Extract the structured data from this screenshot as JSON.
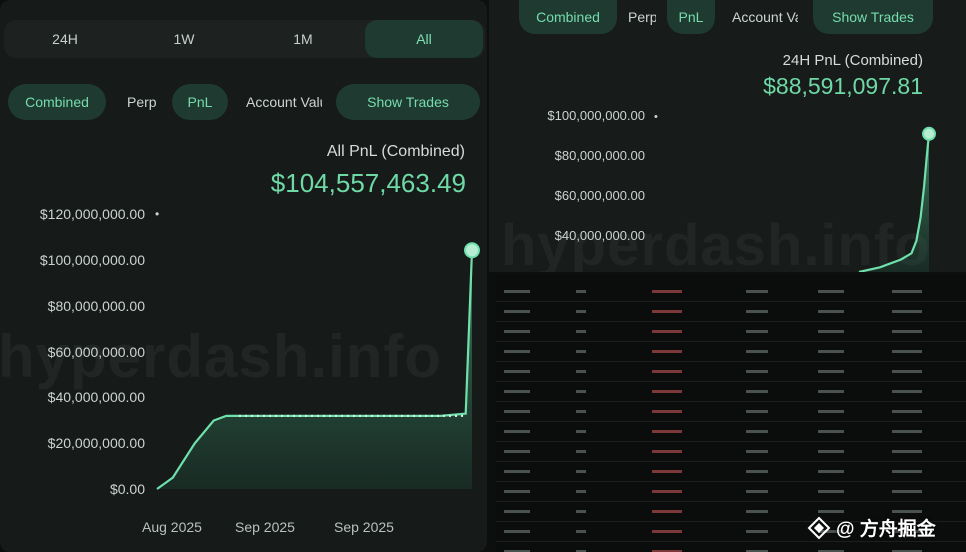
{
  "left": {
    "watermark": "hyperdash.info",
    "timeframes": [
      "24H",
      "1W",
      "1M",
      "All"
    ],
    "active_timeframe": "All",
    "tabs": {
      "combined": "Combined",
      "perp": "Perp",
      "pnl": "PnL",
      "account_value": "Account Value",
      "show_trades": "Show Trades"
    },
    "pnl_label": "All PnL (Combined)",
    "pnl_value": "$104,557,463.49",
    "y_ticks": [
      "$120,000,000.00",
      "$100,000,000.00",
      "$80,000,000.00",
      "$60,000,000.00",
      "$40,000,000.00",
      "$20,000,000.00",
      "$0.00"
    ],
    "x_ticks": [
      "Aug 2025",
      "Sep 2025",
      "Sep 2025"
    ]
  },
  "right_top": {
    "watermark": "hyperdash.info",
    "tabs": {
      "combined": "Combined",
      "perp": "Perp",
      "pnl": "PnL",
      "account_value": "Account Value",
      "show_trades": "Show Trades"
    },
    "pnl_label": "24H PnL (Combined)",
    "pnl_value": "$88,591,097.81",
    "y_ticks": [
      "$100,000,000.00",
      "$80,000,000.00",
      "$60,000,000.00",
      "$40,000,000.00"
    ]
  },
  "footer": {
    "brand": "@ 方舟掘金"
  },
  "colors": {
    "accent": "#6fd9a6",
    "active_bg": "#1f3a30",
    "panel_bg": "#161a19"
  },
  "chart_data": [
    {
      "type": "area",
      "title": "All PnL (Combined)",
      "xlabel": "",
      "ylabel": "",
      "ylim": [
        0,
        120000000
      ],
      "x_ticks": [
        "Aug 2025",
        "Sep 2025",
        "Sep 2025"
      ],
      "x": [
        0,
        0.05,
        0.12,
        0.18,
        0.22,
        0.3,
        0.5,
        0.7,
        0.9,
        0.98,
        1.0
      ],
      "values": [
        0,
        5000000,
        20000000,
        30000000,
        32000000,
        32000000,
        32000000,
        32000000,
        32000000,
        33000000,
        104557463.49
      ]
    },
    {
      "type": "area",
      "title": "24H PnL (Combined)",
      "xlabel": "",
      "ylabel": "",
      "ylim": [
        0,
        100000000
      ],
      "x": [
        0,
        0.3,
        0.6,
        0.75,
        0.82,
        0.88,
        0.93,
        0.97,
        1.0
      ],
      "values": [
        0,
        3000000,
        8000000,
        12000000,
        20000000,
        35000000,
        55000000,
        75000000,
        88591097.81
      ]
    }
  ]
}
